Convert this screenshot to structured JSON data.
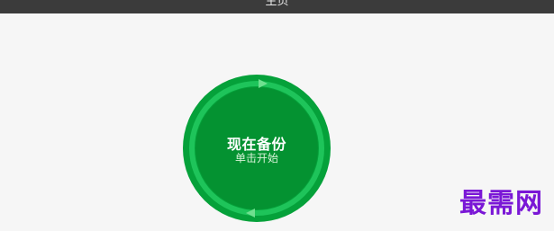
{
  "window": {
    "title": "主页"
  },
  "backup_button": {
    "label": "现在备份",
    "sublabel": "单击开始",
    "colors": {
      "outer": "#05a13a",
      "ring": "#1ec45a",
      "inner": "#049231"
    }
  },
  "watermark": {
    "text": "最需网",
    "color": "#7a17d6"
  }
}
